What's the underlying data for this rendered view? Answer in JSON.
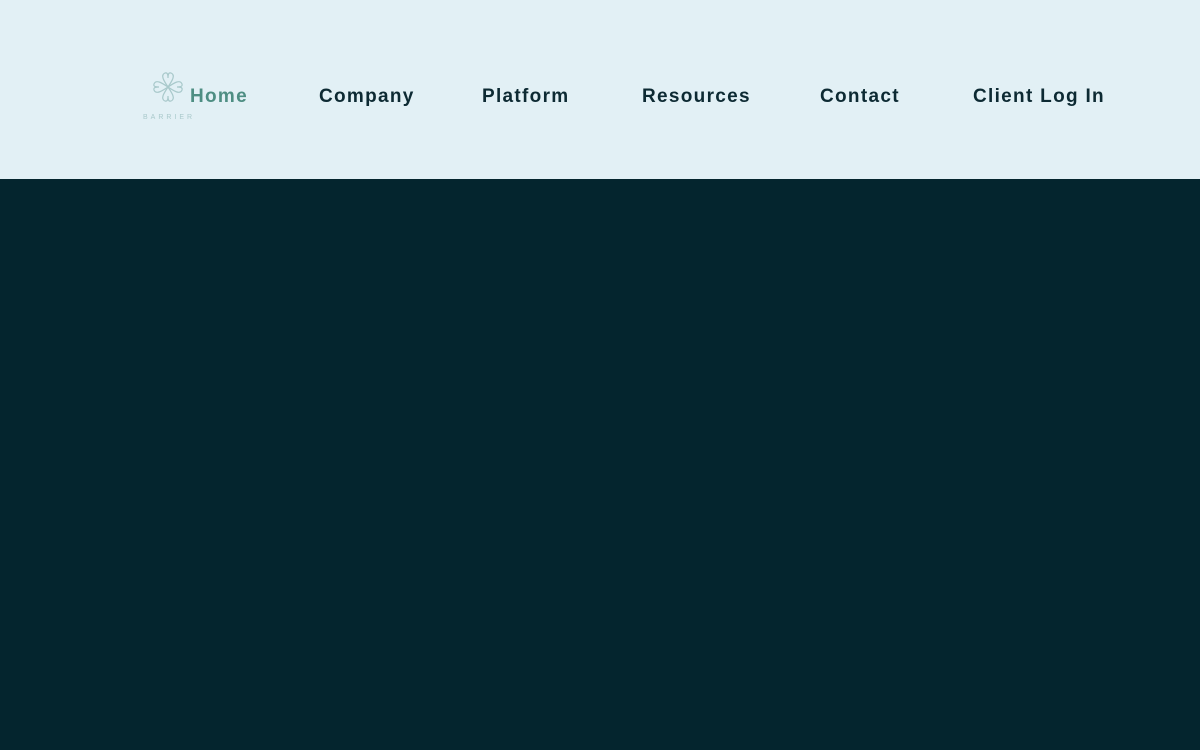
{
  "brand": {
    "wordmark": "BARRIER",
    "logo_icon": "clover-icon",
    "logo_color": "#a9c9cb"
  },
  "nav": {
    "items": [
      {
        "label": "Home",
        "active": true
      },
      {
        "label": "Company",
        "active": false
      },
      {
        "label": "Platform",
        "active": false
      },
      {
        "label": "Resources",
        "active": false
      },
      {
        "label": "Contact",
        "active": false
      },
      {
        "label": "Client Log In",
        "active": false
      }
    ]
  },
  "colors": {
    "header_bg": "#e2f0f5",
    "hero_bg": "#04252e",
    "nav_text": "#0d2a33",
    "nav_active": "#4e8e83"
  }
}
